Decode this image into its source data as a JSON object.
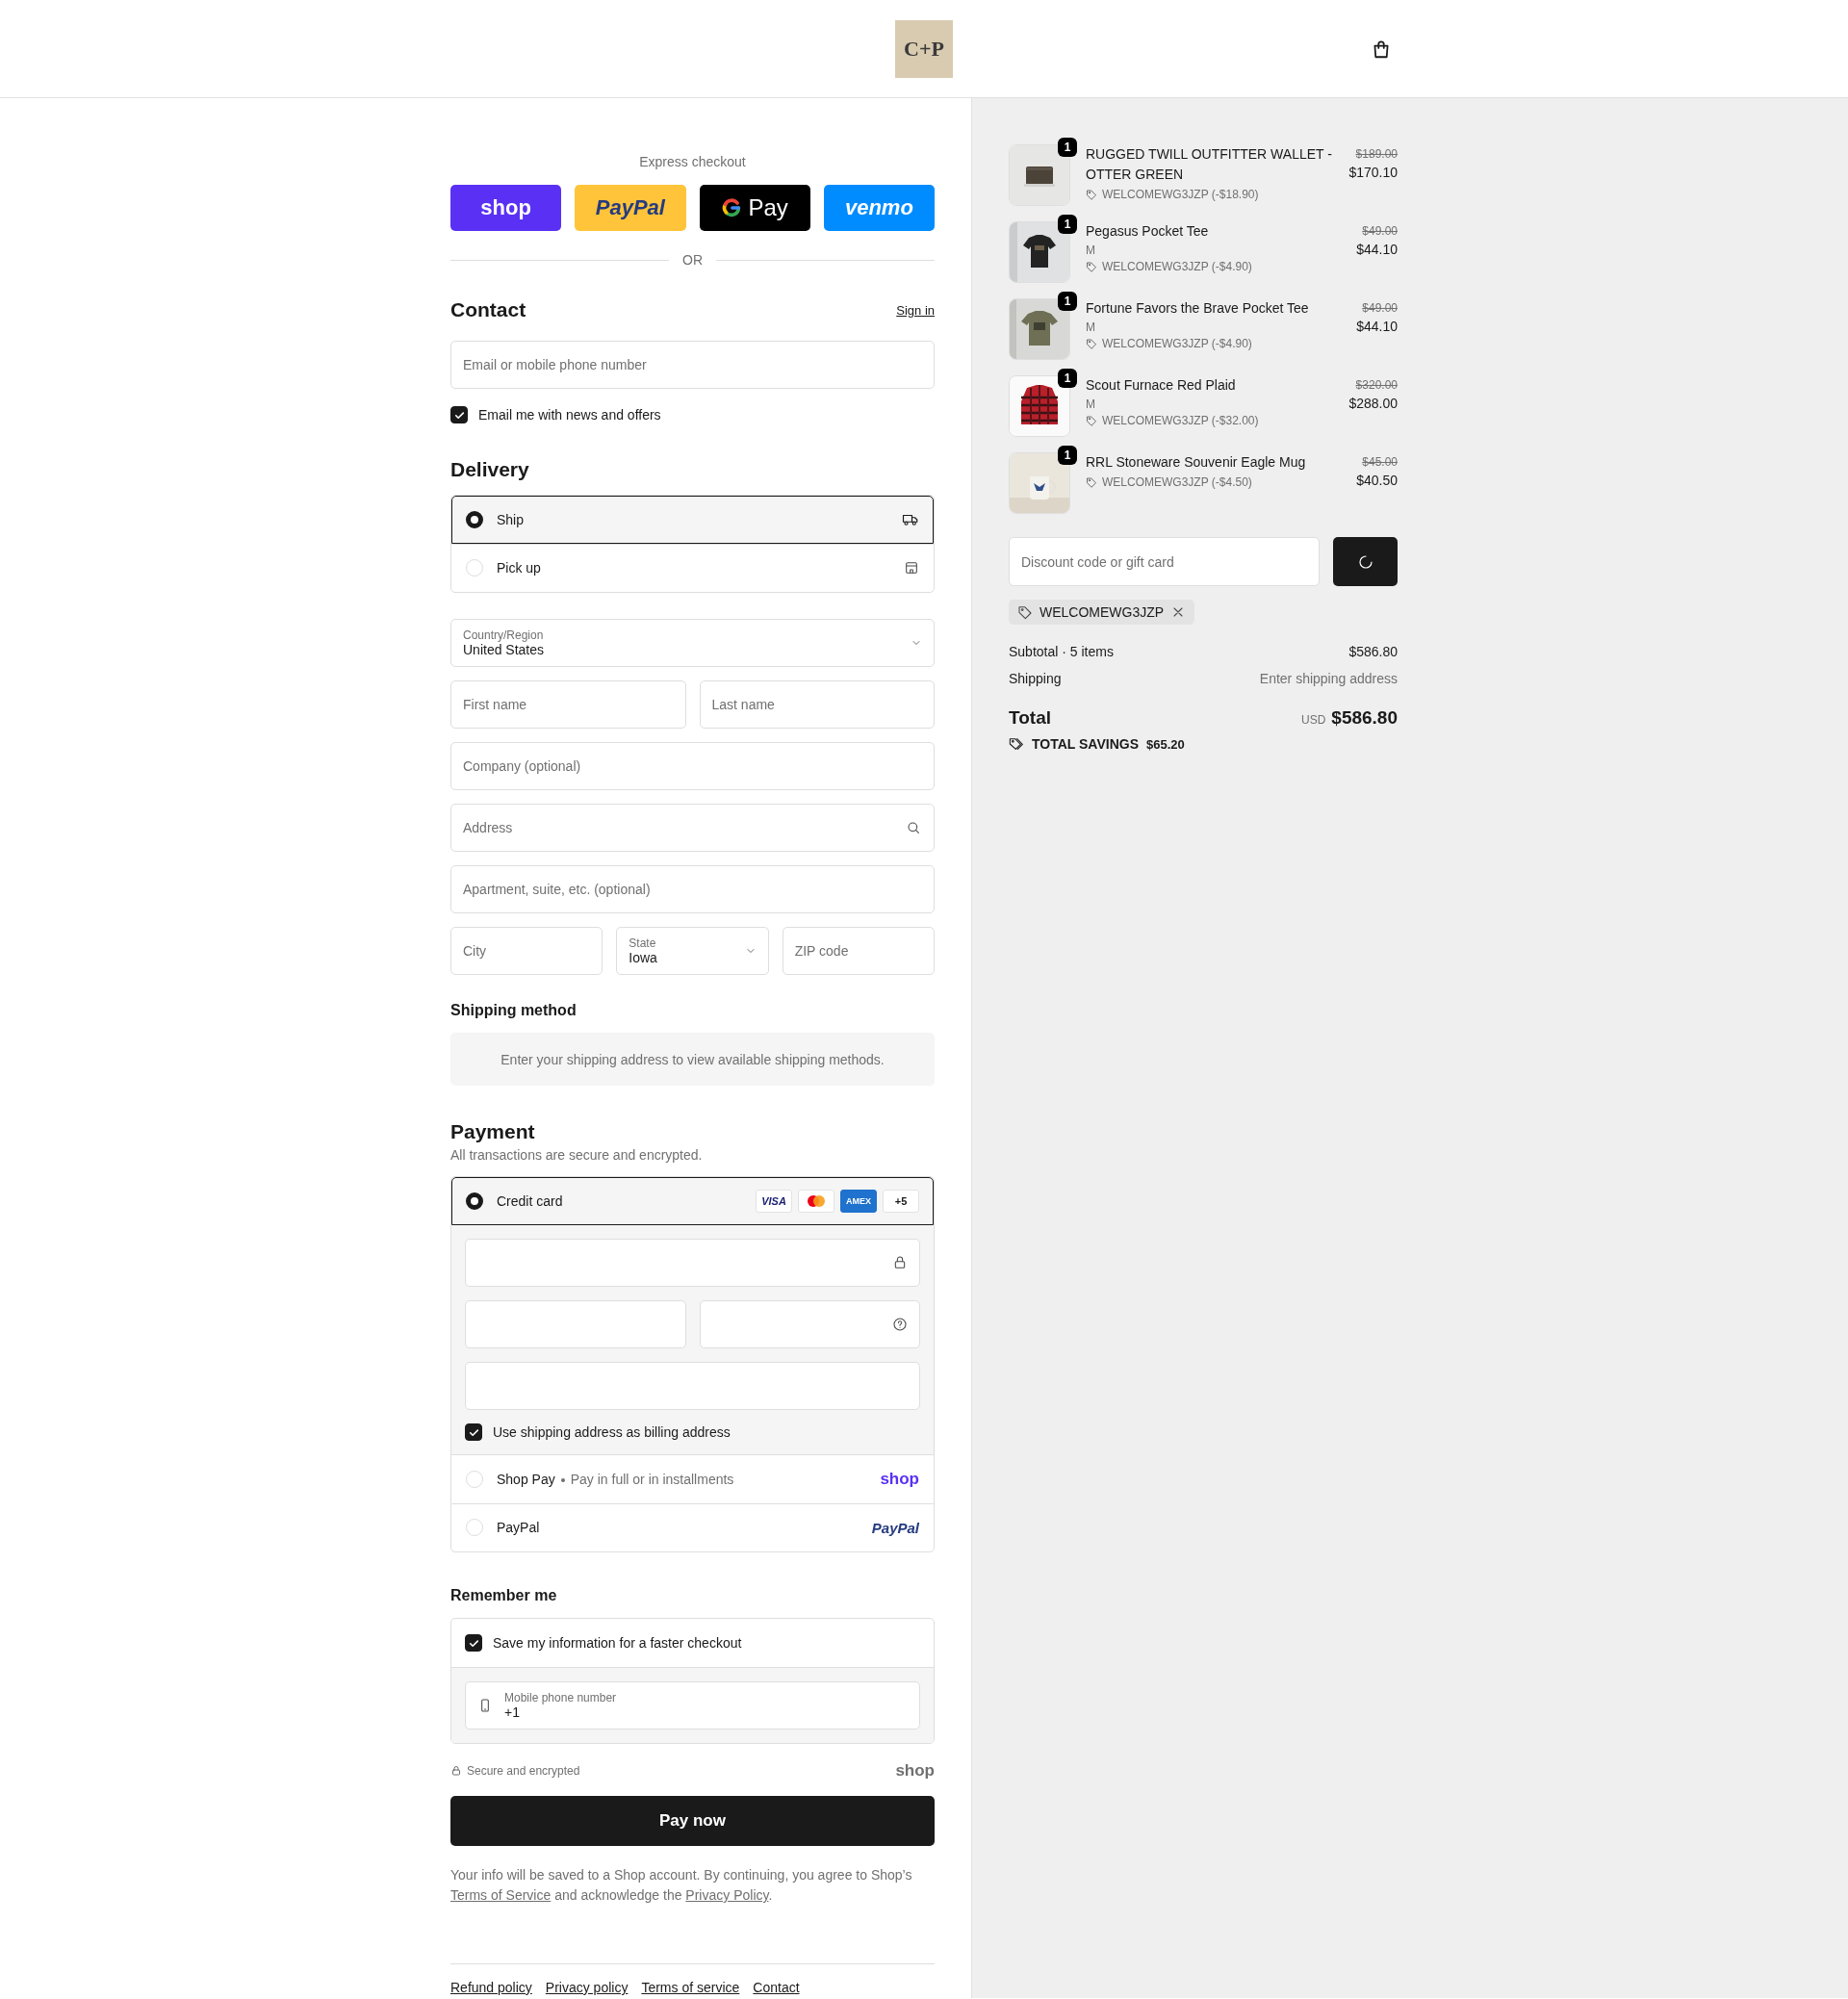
{
  "header": {
    "logo": "C+P"
  },
  "express": {
    "label": "Express checkout",
    "buttons": [
      {
        "kind": "shop",
        "label": "shop"
      },
      {
        "kind": "paypal",
        "label": "PayPal"
      },
      {
        "kind": "gpay",
        "label": "Pay"
      },
      {
        "kind": "venmo",
        "label": "venmo"
      }
    ],
    "divider": "OR"
  },
  "contact": {
    "heading": "Contact",
    "sign_in": "Sign in",
    "email": {
      "placeholder": "Email or mobile phone number"
    },
    "news": {
      "label": "Email me with news and offers",
      "checked": true
    }
  },
  "delivery": {
    "heading": "Delivery",
    "options": [
      {
        "kind": "ship",
        "label": "Ship",
        "selected": true
      },
      {
        "kind": "pickup",
        "label": "Pick up",
        "selected": false
      }
    ],
    "rows": [
      [
        {
          "kind": "select",
          "label": "Country/Region",
          "value": "United States"
        }
      ],
      [
        {
          "kind": "input",
          "placeholder": "First name"
        },
        {
          "kind": "input",
          "placeholder": "Last name"
        }
      ],
      [
        {
          "kind": "input",
          "placeholder": "Company (optional)"
        }
      ],
      [
        {
          "kind": "search",
          "placeholder": "Address"
        }
      ],
      [
        {
          "kind": "input",
          "placeholder": "Apartment, suite, etc. (optional)"
        }
      ],
      [
        {
          "kind": "input",
          "placeholder": "City"
        },
        {
          "kind": "select",
          "label": "State",
          "value": "Iowa"
        },
        {
          "kind": "input",
          "placeholder": "ZIP code"
        }
      ]
    ]
  },
  "shipping_method": {
    "heading": "Shipping method",
    "message": "Enter your shipping address to view available shipping methods."
  },
  "payment": {
    "heading": "Payment",
    "note": "All transactions are secure and encrypted.",
    "methods": [
      {
        "kind": "card",
        "label": "Credit card",
        "selected": true,
        "brands": [
          {
            "kind": "visa",
            "label": "VISA"
          },
          {
            "kind": "mastercard"
          },
          {
            "kind": "amex",
            "label": "AMEX"
          },
          {
            "kind": "more",
            "label": "+5"
          }
        ],
        "billing": {
          "label": "Use shipping address as billing address",
          "checked": true
        }
      },
      {
        "kind": "shoppay",
        "label": "Shop Pay",
        "detail": "Pay in full or in installments",
        "logo": "shop",
        "selected": false
      },
      {
        "kind": "paypal",
        "label": "PayPal",
        "logo": "PayPal",
        "selected": false
      }
    ]
  },
  "remember": {
    "heading": "Remember me",
    "save": {
      "label": "Save my information for a faster checkout",
      "checked": true
    },
    "phone": {
      "label": "Mobile phone number",
      "value": "+1"
    },
    "secure": "Secure and encrypted",
    "logo": "shop"
  },
  "pay_button": "Pay now",
  "legal": [
    {
      "kind": "text",
      "text": "Your info will be saved to a Shop account. By continuing, you agree to Shop’s "
    },
    {
      "kind": "link",
      "text": "Terms of Service"
    },
    {
      "kind": "text",
      "text": " and acknowledge the "
    },
    {
      "kind": "link",
      "text": "Privacy Policy"
    },
    {
      "kind": "text",
      "text": "."
    }
  ],
  "footer_links": [
    "Refund policy",
    "Privacy policy",
    "Terms of service",
    "Contact"
  ],
  "summary": {
    "items": [
      {
        "name": "RUGGED TWILL OUTFITTER WALLET - OTTER GREEN",
        "discount": "WELCOMEWG3JZP (-$18.90)",
        "original_price": "$189.00",
        "price": "$170.10",
        "quantity": "1"
      },
      {
        "name": "Pegasus Pocket Tee",
        "variant": "M",
        "discount": "WELCOMEWG3JZP (-$4.90)",
        "original_price": "$49.00",
        "price": "$44.10",
        "quantity": "1"
      },
      {
        "name": "Fortune Favors the Brave Pocket Tee",
        "variant": "M",
        "discount": "WELCOMEWG3JZP (-$4.90)",
        "original_price": "$49.00",
        "price": "$44.10",
        "quantity": "1"
      },
      {
        "name": "Scout Furnace Red Plaid",
        "variant": "M",
        "discount": "WELCOMEWG3JZP (-$32.00)",
        "original_price": "$320.00",
        "price": "$288.00",
        "quantity": "1"
      },
      {
        "name": "RRL Stoneware Souvenir Eagle Mug",
        "discount": "WELCOMEWG3JZP (-$4.50)",
        "original_price": "$45.00",
        "price": "$40.50",
        "quantity": "1"
      }
    ],
    "discount": {
      "placeholder": "Discount code or gift card"
    },
    "applied_code": "WELCOMEWG3JZP",
    "subtotal": {
      "label": "Subtotal · 5 items",
      "value": "$586.80"
    },
    "shipping": {
      "label": "Shipping",
      "value": "Enter shipping address"
    },
    "total": {
      "label": "Total",
      "currency": "USD",
      "value": "$586.80"
    },
    "savings": {
      "label": "TOTAL SAVINGS",
      "value": "$65.20"
    }
  }
}
